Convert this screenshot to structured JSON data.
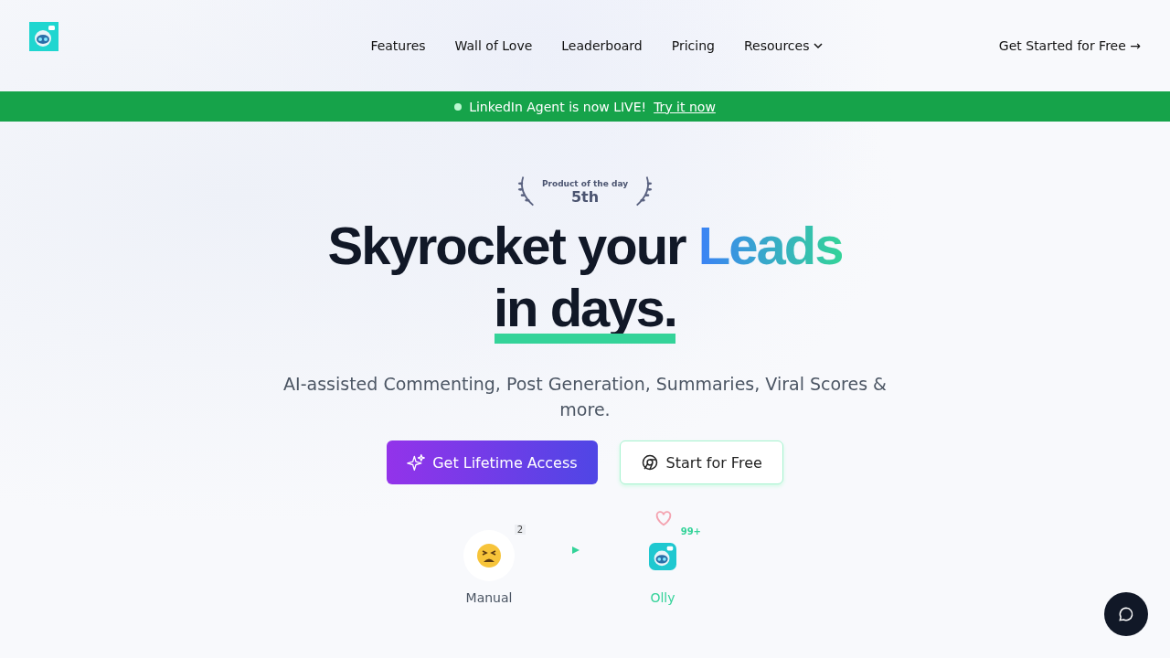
{
  "nav": {
    "items": [
      {
        "label": "Features",
        "dropdown": false
      },
      {
        "label": "Wall of Love",
        "dropdown": false
      },
      {
        "label": "Leaderboard",
        "dropdown": false
      },
      {
        "label": "Pricing",
        "dropdown": false
      },
      {
        "label": "Resources",
        "dropdown": true
      }
    ],
    "cta": "Get Started for Free",
    "cta_arrow": "→"
  },
  "banner": {
    "text": "LinkedIn Agent is now LIVE!",
    "link": "Try it now"
  },
  "award": {
    "title": "Product of the day",
    "rank": "5th"
  },
  "headline": {
    "line1": "Skyrocket your ",
    "highlight": "Leads",
    "line2": "in days."
  },
  "subtitle": "AI-assisted Commenting, Post Generation, Summaries, Viral Scores & more.",
  "buttons": [
    {
      "label": "Get Lifetime Access",
      "kind": "primary"
    },
    {
      "label": "Start for Free",
      "kind": "secondary"
    }
  ],
  "compare": [
    {
      "label": "Manual",
      "badge": "2",
      "kind": "manual"
    },
    {
      "label": "Olly",
      "badge": "99+",
      "kind": "olly"
    }
  ]
}
